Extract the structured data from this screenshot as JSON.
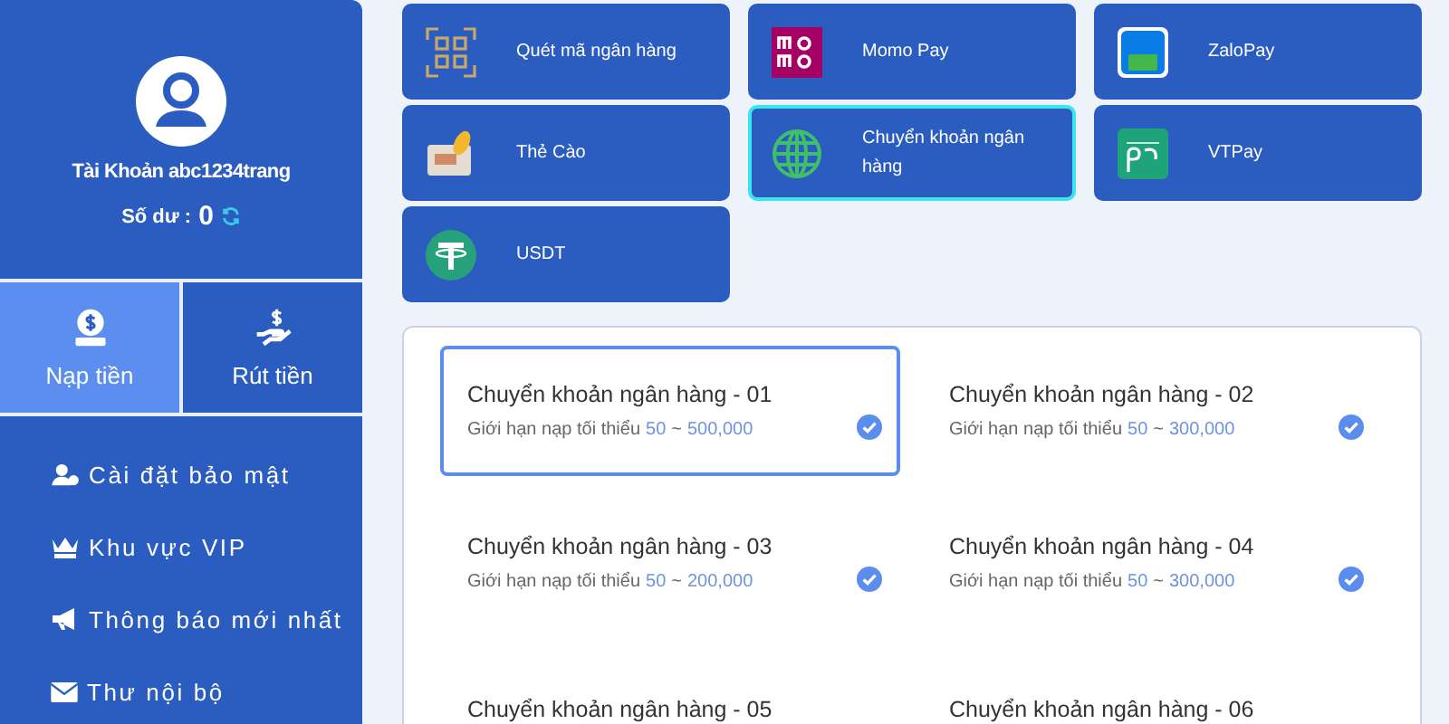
{
  "sidebar": {
    "account_label": "Tài Khoản abc1234trang",
    "balance_label": "Số dư :",
    "balance": "0",
    "actions": [
      {
        "label": "Nạp tiền",
        "selected": true
      },
      {
        "label": "Rút tiền",
        "selected": false
      }
    ],
    "menu": [
      {
        "label": "Cài đặt bảo mật"
      },
      {
        "label": "Khu vực VIP"
      },
      {
        "label": "Thông báo mới nhất"
      },
      {
        "label": "Thư nội bộ"
      }
    ]
  },
  "methods": [
    {
      "label": "Quét mã ngân hàng",
      "selected": false
    },
    {
      "label": "Momo Pay",
      "selected": false
    },
    {
      "label": "ZaloPay",
      "selected": false
    },
    {
      "label": "Thẻ Cào",
      "selected": false
    },
    {
      "label": "Chuyển khoản ngân hàng",
      "selected": true
    },
    {
      "label": "VTPay",
      "selected": false
    },
    {
      "label": "USDT",
      "selected": false
    }
  ],
  "banks": [
    {
      "title": "Chuyển khoản ngân hàng - 01",
      "limit_label": "Giới hạn nạp tối thiểu",
      "min": "50",
      "separator": "~",
      "max": "500,000",
      "selected": true
    },
    {
      "title": "Chuyển khoản ngân hàng - 02",
      "limit_label": "Giới hạn nạp tối thiểu",
      "min": "50",
      "separator": "~",
      "max": "300,000",
      "selected": false
    },
    {
      "title": "Chuyển khoản ngân hàng - 03",
      "limit_label": "Giới hạn nạp tối thiểu",
      "min": "50",
      "separator": "~",
      "max": "200,000",
      "selected": false
    },
    {
      "title": "Chuyển khoản ngân hàng - 04",
      "limit_label": "Giới hạn nạp tối thiểu",
      "min": "50",
      "separator": "~",
      "max": "300,000",
      "selected": false
    },
    {
      "title": "Chuyển khoản ngân hàng - 05",
      "selected": false
    },
    {
      "title": "Chuyển khoản ngân hàng - 06",
      "selected": false
    }
  ]
}
